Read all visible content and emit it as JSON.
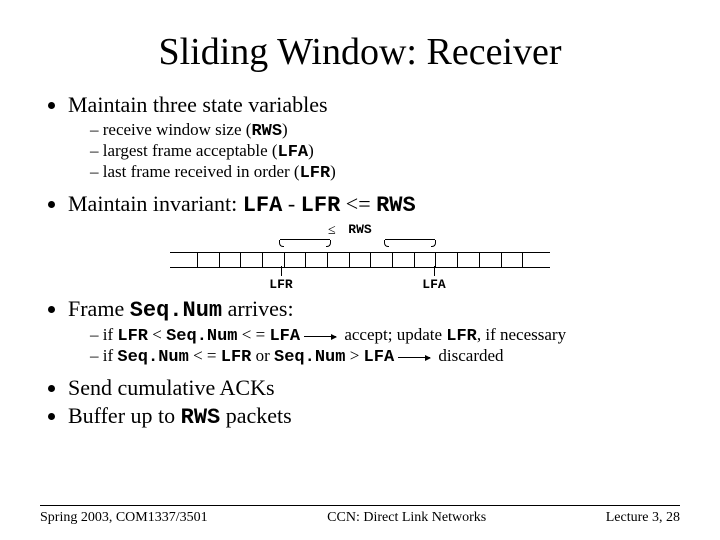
{
  "title": "Sliding Window: Receiver",
  "b1": "Maintain three state variables",
  "b1s1a": "receive window size (",
  "b1s1b": "RWS",
  "b1s1c": ")",
  "b1s2a": "largest frame acceptable (",
  "b1s2b": "LFA",
  "b1s2c": ")",
  "b1s3a": "last frame received in order (",
  "b1s3b": "LFR",
  "b1s3c": ")",
  "b2a": "Maintain invariant: ",
  "b2b": "LFA",
  "b2c": " - ",
  "b2d": "LFR",
  "b2e": " <= ",
  "b2f": "RWS",
  "diag_rws": "RWS",
  "diag_leq": "≤",
  "diag_lfr": "LFR",
  "diag_lfa": "LFA",
  "b3a": "Frame ",
  "b3b": "Seq.Num",
  "b3c": " arrives:",
  "b3s1a": "if ",
  "b3s1b": "LFR",
  "b3s1c": " < ",
  "b3s1d": "Seq.Num",
  "b3s1e": " < = ",
  "b3s1f": "LFA",
  "b3s1g": " accept; update ",
  "b3s1h": "LFR",
  "b3s1i": ", if necessary",
  "b3s2a": "if ",
  "b3s2b": "Seq.Num",
  "b3s2c": " < = ",
  "b3s2d": "LFR",
  "b3s2e": " or ",
  "b3s2f": "Seq.Num",
  "b3s2g": " > ",
  "b3s2h": "LFA",
  "b3s2i": " discarded",
  "b4": "Send cumulative ACKs",
  "b5a": "Buffer up to ",
  "b5b": "RWS",
  "b5c": " packets",
  "foot_left": "Spring 2003, COM1337/3501",
  "foot_center": "CCN: Direct Link Networks",
  "foot_right": "Lecture 3, 28"
}
